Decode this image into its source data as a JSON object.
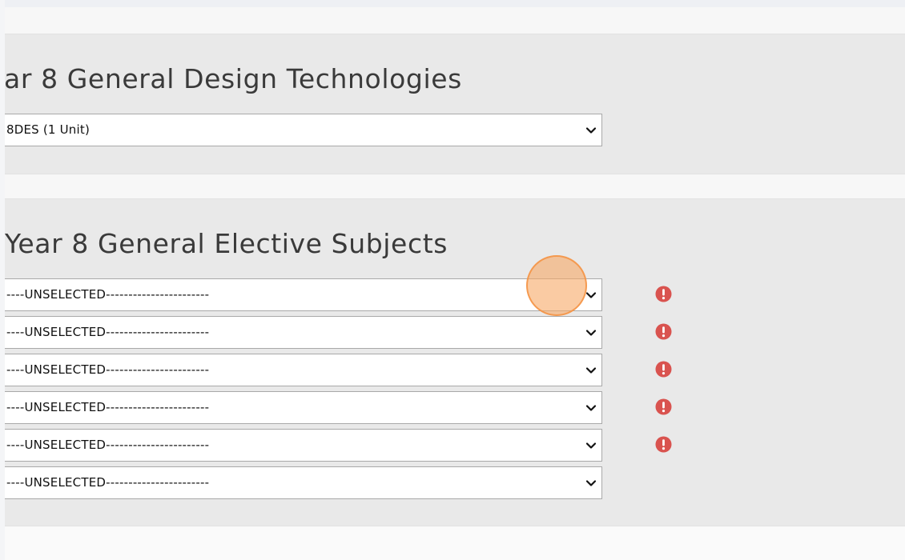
{
  "design_section": {
    "title": "ar 8 General Design Technologies",
    "select_value": "8DES (1 Unit)"
  },
  "elective_section": {
    "title": "Year 8 General Elective Subjects",
    "selects": [
      {
        "value": "----UNSELECTED-----------------------",
        "warning": true
      },
      {
        "value": "----UNSELECTED-----------------------",
        "warning": true
      },
      {
        "value": "----UNSELECTED-----------------------",
        "warning": true
      },
      {
        "value": "----UNSELECTED-----------------------",
        "warning": true
      },
      {
        "value": "----UNSELECTED-----------------------",
        "warning": true
      },
      {
        "value": "----UNSELECTED-----------------------",
        "warning": false
      }
    ]
  },
  "colors": {
    "panel_background": "#e9e9e9",
    "warning_red": "#d9534f",
    "cursor_highlight": "#f7a866"
  },
  "icons": {
    "dropdown": "chevron-down-icon",
    "warning": "exclamation-circle-icon"
  }
}
